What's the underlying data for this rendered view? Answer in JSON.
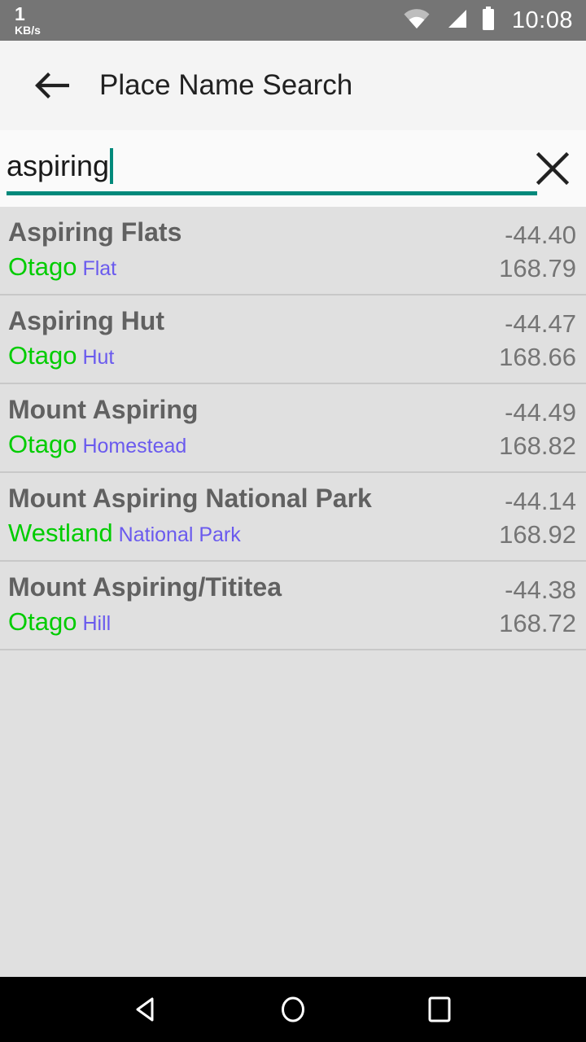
{
  "status_bar": {
    "net_rate": "1",
    "net_unit": "KB/s",
    "wifi_icon": "wifi-icon",
    "signal_icon": "cell-signal-icon",
    "battery_icon": "battery-icon",
    "clock": "10:08",
    "background_color": "#757575"
  },
  "app_bar": {
    "back_icon": "back-arrow-icon",
    "title": "Place Name Search",
    "background_color": "#f4f4f4"
  },
  "search": {
    "value": "aspiring",
    "placeholder": "Search place name",
    "clear_icon": "close-icon",
    "accent_color": "#00897b"
  },
  "results": [
    {
      "name": "Aspiring Flats",
      "region": "Otago",
      "feature": "Flat",
      "lat": "-44.40",
      "lon": "168.79"
    },
    {
      "name": "Aspiring Hut",
      "region": "Otago",
      "feature": "Hut",
      "lat": "-44.47",
      "lon": "168.66"
    },
    {
      "name": "Mount Aspiring",
      "region": "Otago",
      "feature": "Homestead",
      "lat": "-44.49",
      "lon": "168.82"
    },
    {
      "name": "Mount Aspiring National Park",
      "region": "Westland",
      "feature": "National Park",
      "lat": "-44.14",
      "lon": "168.92"
    },
    {
      "name": "Mount Aspiring/Tititea",
      "region": "Otago",
      "feature": "Hill",
      "lat": "-44.38",
      "lon": "168.72"
    }
  ],
  "colors": {
    "region_text": "#00cc00",
    "feature_text": "#6a5aee",
    "name_text": "#616161",
    "coord_text": "#757575",
    "list_background": "#e0e0e0"
  },
  "nav_bar": {
    "back_icon": "nav-back-triangle-icon",
    "home_icon": "nav-home-circle-icon",
    "recents_icon": "nav-recents-square-icon",
    "background_color": "#000000"
  }
}
